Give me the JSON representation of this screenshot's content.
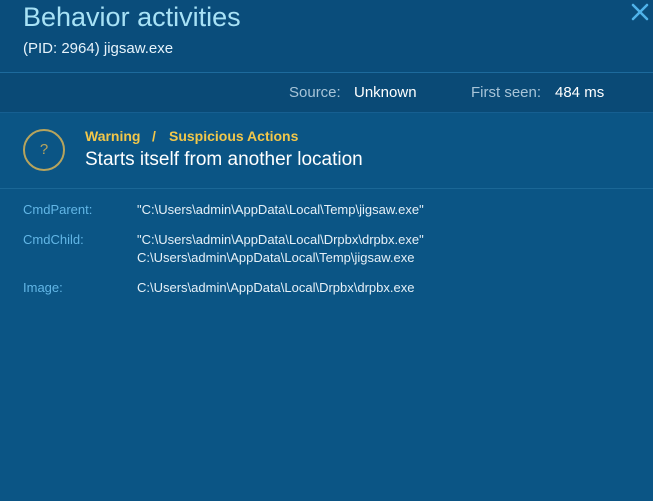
{
  "header": {
    "title": "Behavior activities",
    "subtitle": "(PID: 2964) jigsaw.exe"
  },
  "meta": {
    "source_label": "Source:",
    "source_value": "Unknown",
    "first_seen_label": "First seen:",
    "first_seen_value": "484 ms"
  },
  "warning": {
    "icon_glyph": "?",
    "severity": "Warning",
    "separator": "/",
    "category": "Suspicious Actions",
    "title": "Starts itself from another location"
  },
  "details": [
    {
      "label": "CmdParent:",
      "lines": [
        "\"C:\\Users\\admin\\AppData\\Local\\Temp\\jigsaw.exe\""
      ]
    },
    {
      "label": "CmdChild:",
      "lines": [
        "\"C:\\Users\\admin\\AppData\\Local\\Drpbx\\drpbx.exe\"",
        "C:\\Users\\admin\\AppData\\Local\\Temp\\jigsaw.exe"
      ]
    },
    {
      "label": "Image:",
      "lines": [
        "C:\\Users\\admin\\AppData\\Local\\Drpbx\\drpbx.exe"
      ]
    }
  ],
  "colors": {
    "background": "#0b5585",
    "title": "#a8e2f6",
    "warning_text": "#f2c74a",
    "warning_icon": "#b7a45d",
    "detail_label": "#62b6e6"
  }
}
